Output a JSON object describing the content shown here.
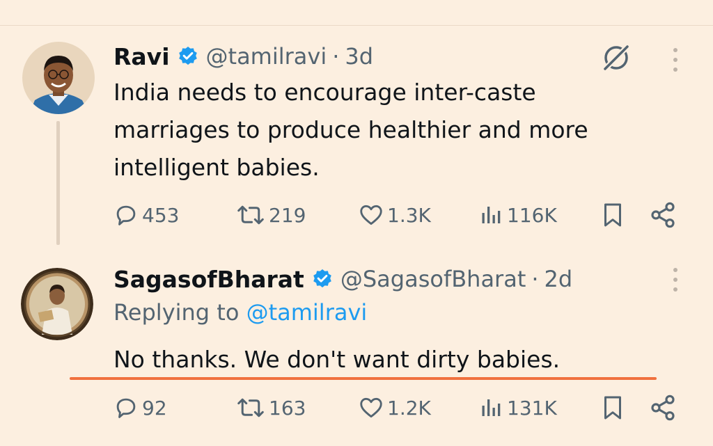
{
  "tweets": [
    {
      "name": "Ravi",
      "handle": "@tamilravi",
      "time": "3d",
      "text": "India needs to encourage inter-caste marriages to produce healthier and more intelligent babies.",
      "stats": {
        "replies": "453",
        "reposts": "219",
        "likes": "1.3K",
        "views": "116K"
      }
    },
    {
      "name": "SagasofBharat",
      "handle": "@SagasofBharat",
      "time": "2d",
      "replying_prefix": "Replying to",
      "replying_handle": "@tamilravi",
      "text": "No thanks. We don't want dirty babies.",
      "stats": {
        "replies": "92",
        "reposts": "163",
        "likes": "1.2K",
        "views": "131K"
      }
    }
  ],
  "separator": "·",
  "icons": {
    "verified": "verified-badge-icon",
    "grok": "grok-icon",
    "more": "more-options-icon",
    "reply": "reply-icon",
    "repost": "repost-icon",
    "like": "like-icon",
    "views": "views-icon",
    "bookmark": "bookmark-icon",
    "share": "share-icon"
  },
  "colors": {
    "background": "#fcefe0",
    "verified": "#1d9bf0",
    "link": "#1d9bf0",
    "secondary_text": "#536471",
    "annotation_underline": "#f0703e"
  }
}
